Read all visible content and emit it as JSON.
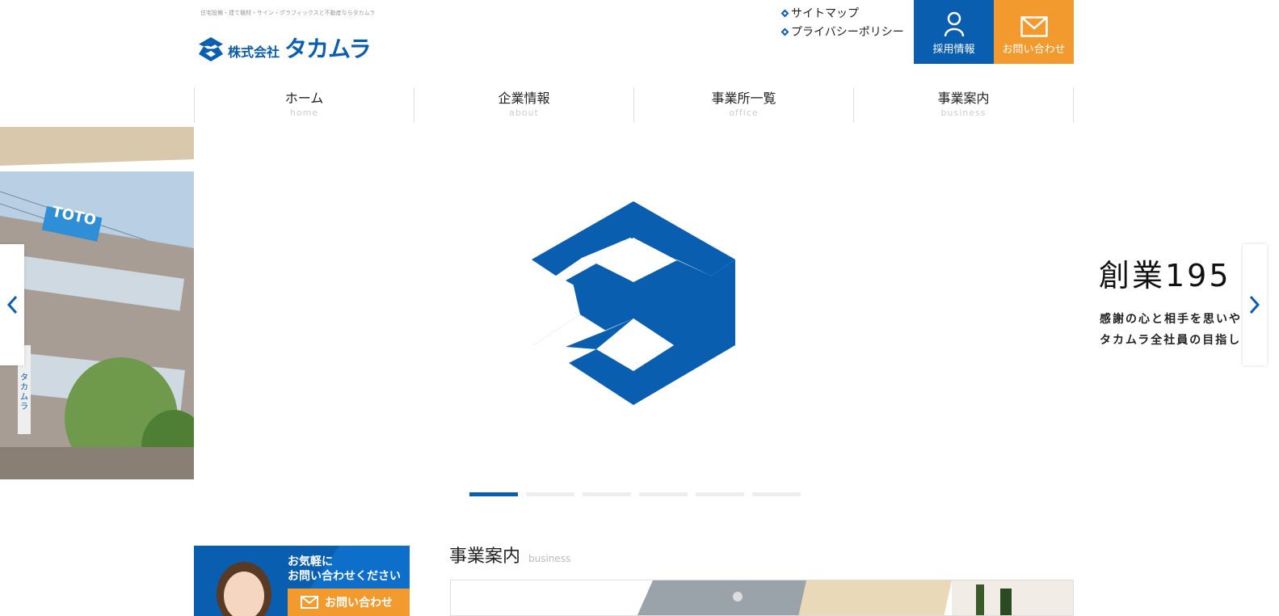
{
  "header": {
    "tagline": "住宅設備・建て機材・サイン・グラフィックスと不動産ならタカムラ",
    "logo_small": "株式会社",
    "logo_big": "タカムラ",
    "util_links": [
      {
        "label": "サイトマップ"
      },
      {
        "label": "プライバシーポリシー"
      }
    ],
    "recruit_label": "採用情報",
    "contact_label": "お問い合わせ",
    "colors": {
      "brand": "#0a5eb0",
      "accent": "#f29a2e"
    }
  },
  "nav": [
    {
      "jp": "ホーム",
      "en": "home"
    },
    {
      "jp": "企業情報",
      "en": "about"
    },
    {
      "jp": "事業所一覧",
      "en": "office"
    },
    {
      "jp": "事業案内",
      "en": "business"
    }
  ],
  "slider": {
    "next_title": "創業195",
    "next_line1": "感謝の心と相手を思いや",
    "next_line2": "タカムラ全社員の目指し",
    "photo_sign": "TOTO",
    "photo_vertical_sign": "タカムラ",
    "slide_count": 6,
    "active_index": 0
  },
  "banner": {
    "line1": "お気軽に",
    "line2": "お問い合わせください",
    "button_label": "お問い合わせ"
  },
  "section": {
    "title_jp": "事業案内",
    "title_en": "business"
  }
}
